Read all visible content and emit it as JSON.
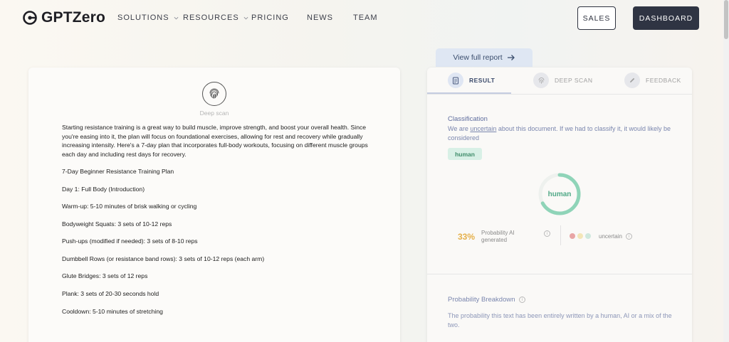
{
  "nav": {
    "brand": "GPTZero",
    "items": [
      {
        "label": "SOLUTIONS",
        "dropdown": true
      },
      {
        "label": "RESOURCES",
        "dropdown": true
      },
      {
        "label": "PRICING",
        "dropdown": false
      },
      {
        "label": "NEWS",
        "dropdown": false
      },
      {
        "label": "TEAM",
        "dropdown": false
      }
    ],
    "sales_label": "SALES",
    "dashboard_label": "DASHBOARD"
  },
  "document": {
    "deep_scan_label": "Deep scan",
    "intro": "Starting resistance training is a great way to build muscle, improve strength, and boost your overall health. Since you're easing into it, the plan will focus on foundational exercises, allowing for rest and recovery while gradually increasing intensity. Here's a 7-day plan that incorporates full-body workouts, focusing on different muscle groups each day and including rest days for recovery.",
    "lines": [
      "7-Day Beginner Resistance Training Plan",
      "Day 1: Full Body (Introduction)",
      "Warm-up: 5-10 minutes of brisk walking or cycling",
      "Bodyweight Squats: 3 sets of 10-12 reps",
      "Push-ups (modified if needed): 3 sets of 8-10 reps",
      "Dumbbell Rows (or resistance band rows): 3 sets of 10-12 reps (each arm)",
      "Glute Bridges: 3 sets of 12 reps",
      "Plank: 3 sets of 20-30 seconds hold",
      "Cooldown: 5-10 minutes of stretching"
    ]
  },
  "result": {
    "view_report_label": "View full report",
    "tabs": [
      {
        "label": "RESULT",
        "active": true,
        "icon": "document-icon"
      },
      {
        "label": "DEEP SCAN",
        "active": false,
        "icon": "fingerprint-icon"
      },
      {
        "label": "FEEDBACK",
        "active": false,
        "icon": "pencil-icon"
      }
    ],
    "classification_title": "Classification",
    "classification_desc_pre": "We are ",
    "classification_desc_uncertain": "uncertain",
    "classification_desc_post": " about this document. If we had to classify it, it would likely be considered",
    "badge": "human",
    "ring_label": "human",
    "ring_fraction": 0.67,
    "probability_value": "33%",
    "probability_label": "Probability AI generated",
    "uncertain_label": "uncertain",
    "breakdown_title": "Probability Breakdown",
    "breakdown_desc": "The probability this text has been entirely written by a human, AI or a mix of the two.",
    "colors": {
      "human": "#8fd4b8",
      "ai": "#e5b04a",
      "uncertain_dot_1": "#e8a5a5",
      "uncertain_dot_2": "#f3e6b8",
      "uncertain_dot_3": "#cfe8de"
    }
  }
}
